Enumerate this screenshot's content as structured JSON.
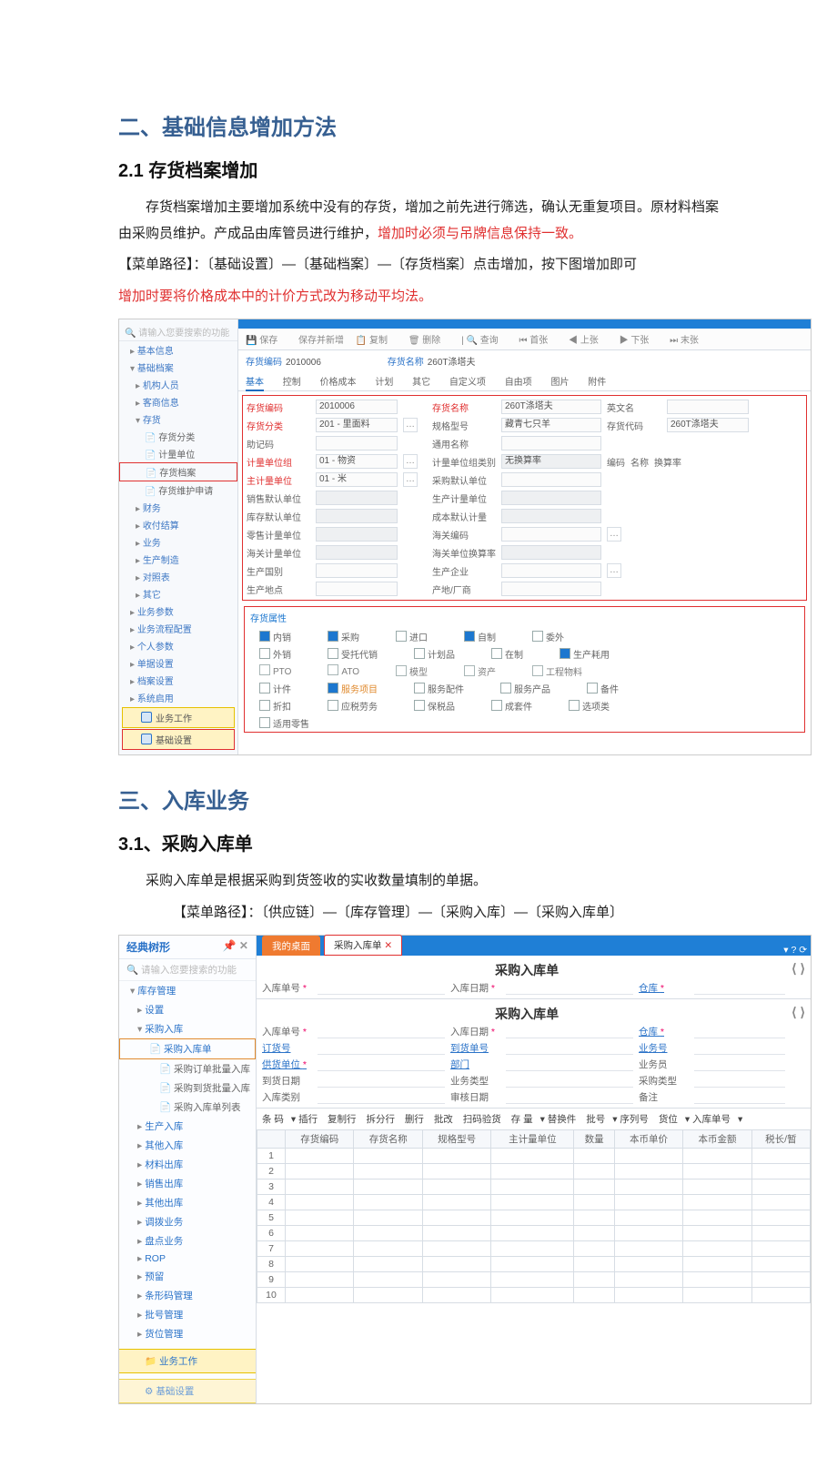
{
  "doc": {
    "sec2_title": "二、基础信息增加方法",
    "sec21_title": "2.1 存货档案增加",
    "p1a": "存货档案增加主要增加系统中没有的存货，增加之前先进行筛选，确认无重复项目。原材料档案由采购员维护。产成品由库管员进行维护，",
    "p1b_red": "增加时必须与吊牌信息保持一致。",
    "p2": "【菜单路径】：〔基础设置〕—〔基础档案〕—〔存货档案〕点击增加，按下图增加即可",
    "p3_red": "增加时要将价格成本中的计价方式改为移动平均法。",
    "sec3_title": "三、入库业务",
    "sec31_title": "3.1、采购入库单",
    "p4": "采购入库单是根据采购到货签收的实收数量填制的单据。",
    "p5": "【菜单路径】：〔供应链〕—〔库存管理〕—〔采购入库〕—〔采购入库单〕"
  },
  "s1": {
    "search_ph": "请输入您要搜索的功能",
    "nav": {
      "a": "基本信息",
      "b": "基础档案",
      "c": "机构人员",
      "d": "客商信息",
      "e": "存货",
      "f": "存货分类",
      "g": "计量单位",
      "h": "存货档案",
      "i": "存货维护申请",
      "j": "财务",
      "k": "收付结算",
      "l": "业务",
      "m": "生产制造",
      "n": "对照表",
      "o": "其它",
      "p": "业务参数",
      "q": "业务流程配置",
      "r": "个人参数",
      "s": "单据设置",
      "t": "档案设置",
      "u": "系统启用",
      "v": "业务工作",
      "w": "基础设置"
    },
    "tb": {
      "a": "保存",
      "b": "保存并新增",
      "c": "复制",
      "d": "删除",
      "e": "查询",
      "f": "首张",
      "g": "上张",
      "h": "下张",
      "i": "末张"
    },
    "code_l": "存货编码",
    "code_v": "2010006",
    "name_l": "存货名称",
    "name_v": "260T涤塔夫",
    "tabs": [
      "基本",
      "控制",
      "价格成本",
      "计划",
      "其它",
      "自定义项",
      "自由项",
      "图片",
      "附件"
    ],
    "form": {
      "l_code": "存货编码",
      "v_code": "2010006",
      "l_name": "存货名称",
      "v_name": "260T涤塔夫",
      "l_en": "英文名",
      "l_cat": "存货分类",
      "v_cat": "201 - 里面料",
      "l_spec": "规格型号",
      "v_spec": "藏青七只羊",
      "l_dm": "存货代码",
      "v_dm": "260T涤塔夫",
      "l_mem": "助记码",
      "l_cn": "通用名称",
      "l_gu": "计量单位组",
      "v_gu": "01 - 物资",
      "l_gt": "计量单位组类别",
      "v_gt": "无换算率",
      "l_tb1": "编码",
      "l_tb2": "名称",
      "l_tb3": "换算率",
      "l_mu": "主计量单位",
      "v_mu": "01 - 米",
      "l_pd": "采购默认单位",
      "l_sd": "销售默认单位",
      "l_pj": "生产计量单位",
      "l_kd": "库存默认单位",
      "l_cj": "成本默认计量",
      "l_rd": "零售计量单位",
      "l_hc": "海关编码",
      "l_hd": "海关计量单位",
      "l_hh": "海关单位换算率",
      "l_gc": "生产国别",
      "l_qy": "生产企业",
      "l_gd": "生产地点",
      "l_cf": "产地/厂商"
    },
    "attr": {
      "hd": "存货属性",
      "r1": [
        "内销",
        "采购",
        "进口",
        "自制",
        "委外"
      ],
      "r2": [
        "外销",
        "受托代销",
        "计划品",
        "在制",
        "生产耗用"
      ],
      "r3": [
        "PTO",
        "ATO",
        "模型",
        "资产",
        "工程物料"
      ],
      "r4": [
        "计件",
        "服务项目",
        "服务配件",
        "服务产品",
        "备件"
      ],
      "r5": [
        "折扣",
        "应税劳务",
        "保税品",
        "成套件",
        "选项类"
      ],
      "r6": [
        "适用零售"
      ]
    }
  },
  "s2": {
    "hdr": "经典树形",
    "search_ph": "请输入您要搜索的功能",
    "nav": {
      "a": "库存管理",
      "b": "设置",
      "c": "采购入库",
      "d": "采购入库单",
      "e": "采购订单批量入库",
      "f": "采购到货批量入库",
      "g": "采购入库单列表",
      "h": "生产入库",
      "i": "其他入库",
      "j": "材料出库",
      "k": "销售出库",
      "l": "其他出库",
      "m": "调拨业务",
      "n": "盘点业务",
      "o": "ROP",
      "p": "预留",
      "q": "条形码管理",
      "r": "批号管理",
      "s": "货位管理",
      "bt": "业务工作",
      "bt2": "基础设置"
    },
    "tab_my": "我的桌面",
    "tab_form": "采购入库单",
    "title": "采购入库单",
    "fields": {
      "no": "入库单号",
      "date": "入库日期",
      "wh": "仓库",
      "ord": "订货号",
      "arr": "到货单号",
      "biz": "业务号",
      "sup": "供货单位",
      "dep": "部门",
      "per": "业务员",
      "adate": "到货日期",
      "btype": "业务类型",
      "ptype": "采购类型",
      "itype": "入库类别",
      "rdate": "审核日期",
      "rem": "备注"
    },
    "ops": [
      "条 码",
      "插行",
      "复制行",
      "拆分行",
      "删行",
      "批改",
      "扫码验货",
      "存 量",
      "替换件",
      "批号",
      "序列号",
      "货位",
      "入库单号"
    ],
    "cols": [
      "",
      "存货编码",
      "存货名称",
      "规格型号",
      "主计量单位",
      "数量",
      "本币单价",
      "本币金额",
      "税长/暂"
    ],
    "rows": [
      "1",
      "2",
      "3",
      "4",
      "5",
      "6",
      "7",
      "8",
      "9",
      "10"
    ]
  }
}
